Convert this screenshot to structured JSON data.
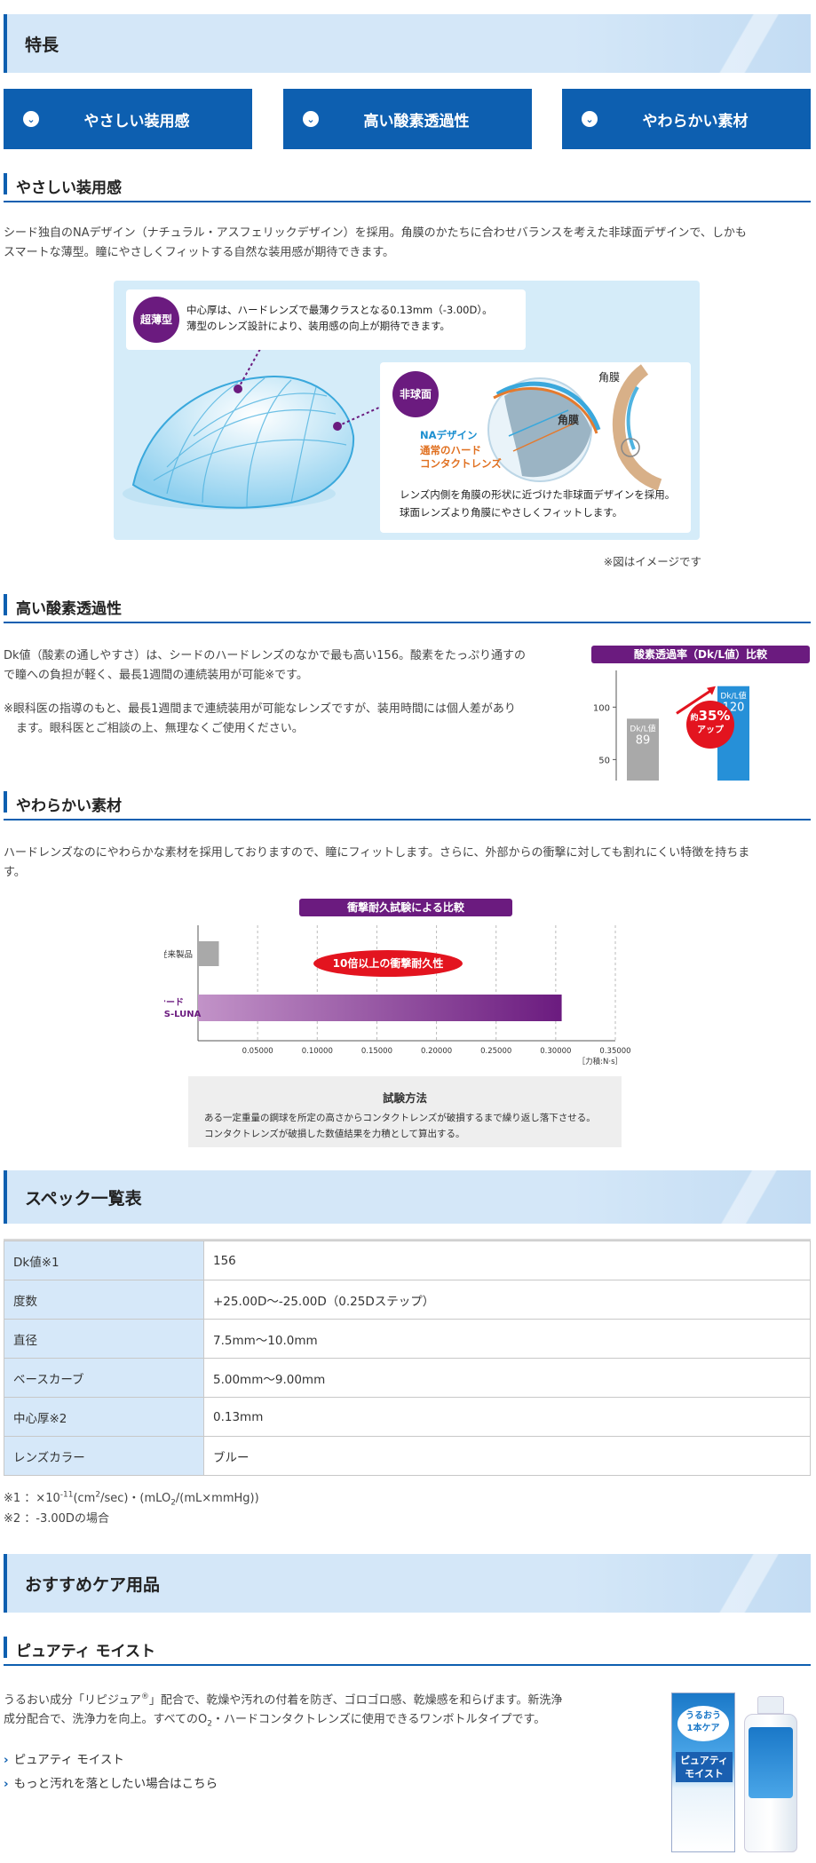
{
  "sections": {
    "features_title": "特長",
    "spec_title": "スペック一覧表",
    "care_title": "おすすめケア用品"
  },
  "feature_buttons": [
    {
      "label": "やさしい装用感"
    },
    {
      "label": "高い酸素透過性"
    },
    {
      "label": "やわらかい素材"
    }
  ],
  "comfort": {
    "heading": "やさしい装用感",
    "text_line1": "シード独自のNAデザイン（ナチュラル・アスフェリックデザイン）を採用。角膜のかたちに合わせバランスを考えた非球面デザインで、しかも",
    "text_line2": "スマートな薄型。瞳にやさしくフィットする自然な装用感が期待できます。",
    "diagram": {
      "badge_thin": "超薄型",
      "thin_line1": "中心厚は、ハードレンズで最薄クラスとなる0.13mm（-3.00D）。",
      "thin_line2": "薄型のレンズ設計により、装用感の向上が期待できます。",
      "badge_aspheric": "非球面",
      "cornea_small": "角膜",
      "cornea_big": "角膜",
      "na_design": "NAデザイン",
      "normal_lens_1": "通常のハード",
      "normal_lens_2": "コンタクトレンズ",
      "aspheric_line1": "レンズ内側を角膜の形状に近づけた非球面デザインを採用。",
      "aspheric_line2": "球面レンズより角膜にやさしくフィットします。"
    },
    "image_note": "※図はイメージです"
  },
  "oxygen": {
    "heading": "高い酸素透過性",
    "text_line1": "Dk値（酸素の通しやすさ）は、シードのハードレンズのなかで最も高い156。酸素をたっぷり通すの",
    "text_line2": "で瞳への負担が軽く、最長1週間の連続装用が可能※です。",
    "note_line1": "※眼科医の指導のもと、最長1週間まで連続装用が可能なレンズですが、装用時間には個人差があり",
    "note_line2": "ます。眼科医とご相談の上、無理なくご使用ください。",
    "chart_title": "酸素透過率（Dk/L値）比較",
    "badge_prefix": "約",
    "badge_pct": "35%",
    "badge_suffix": "アップ"
  },
  "soft": {
    "heading": "やわらかい素材",
    "text_line1": "ハードレンズなのにやわらかな素材を採用しておりますので、瞳にフィットします。さらに、外部からの衝撃に対しても割れにくい特徴を持ちま",
    "text_line2": "す。",
    "chart_title": "衝撃耐久試験による比較",
    "callout": "10倍以上の衝撃耐久性",
    "unit": "［力積:N·s］",
    "method_title": "試験方法",
    "method_line1": "ある一定重量の鋼球を所定の高さからコンタクトレンズが破損するまで繰り返し落下させる。",
    "method_line2": "コンタクトレンズが破損した数値結果を力積として算出する。"
  },
  "chart_data": [
    {
      "type": "bar",
      "title": "酸素透過率（Dk/L値）比較",
      "categories": [
        "Dk/L値 89",
        "Dk/L値 120"
      ],
      "series": [
        {
          "values": [
            89,
            120
          ]
        }
      ],
      "bar_labels": [
        [
          "Dk/L値",
          "89"
        ],
        [
          "Dk/L値",
          "120"
        ]
      ],
      "yticks": [
        50,
        100
      ],
      "ylim": [
        30,
        135
      ],
      "annotation": "約35%アップ"
    },
    {
      "type": "bar",
      "orientation": "horizontal",
      "title": "衝撃耐久試験による比較",
      "categories": [
        "当社従来製品",
        "シード AS-LUNA"
      ],
      "series": [
        {
          "values": [
            0.0175,
            0.305
          ]
        }
      ],
      "xticks": [
        "0.05000",
        "0.10000",
        "0.15000",
        "0.20000",
        "0.25000",
        "0.30000",
        "0.35000"
      ],
      "xlim": [
        0,
        0.35
      ],
      "xlabel": "［力積:N·s］",
      "annotation": "10倍以上の衝撃耐久性"
    }
  ],
  "spec_table": {
    "rows": [
      {
        "key": "Dk値※1",
        "value": "156"
      },
      {
        "key": "度数",
        "value": "+25.00D〜-25.00D（0.25Dステップ）"
      },
      {
        "key": "直径",
        "value": "7.5mm〜10.0mm"
      },
      {
        "key": "ベースカーブ",
        "value": "5.00mm〜9.00mm"
      },
      {
        "key": "中心厚※2",
        "value": "0.13mm"
      },
      {
        "key": "レンズカラー",
        "value": "ブルー"
      }
    ],
    "note1_prefix": "※1 ：×10",
    "note1_exp": "-11",
    "note1_mid": "(cm",
    "note1_sq": "2",
    "note1_mid2": "/sec)・(mLO",
    "note1_sub": "2",
    "note1_tail": "/(mL×mmHg))",
    "note2": "※2 ：-3.00Dの場合"
  },
  "care": {
    "heading": "ピュアティ モイスト",
    "text_line1": "うるおい成分「リピジュア",
    "text_reg": "®",
    "text_line1b": "」配合で、乾燥や汚れの付着を防ぎ、ゴロゴロ感、乾燥感を和らげます。新洗浄",
    "text_line2a": "成分配合で、洗浄力を向上。すべてのO",
    "text_sub": "2",
    "text_line2b": "・ハードコンタクトレンズに使用できるワンボトルタイプです。",
    "link1": "ピュアティ モイスト",
    "link2": "もっと汚れを落としたい場合はこちら",
    "product_box_1": "うるおう",
    "product_box_2": "1本ケア",
    "product_name_1": "ピュアティ",
    "product_name_2": "モイスト"
  },
  "colors": {
    "primary": "#0d5fb0",
    "band": "#d4e7f8",
    "purple": "#6b1b7f",
    "red": "#e3141f"
  }
}
